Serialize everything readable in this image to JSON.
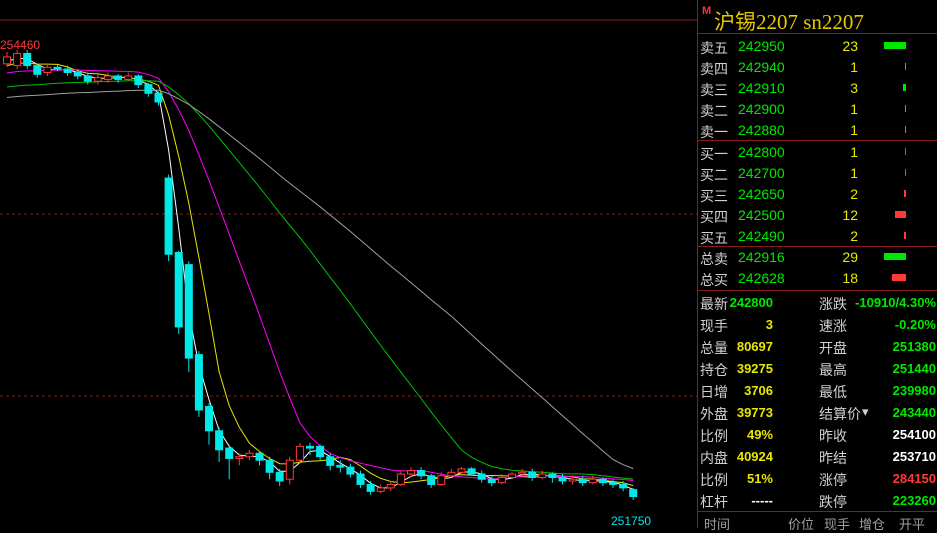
{
  "instrument": {
    "badge": "M",
    "title": "沪锡2207  sn2207"
  },
  "chart": {
    "high_label": "254460",
    "low_label": "251750"
  },
  "asks": [
    {
      "label": "卖五",
      "price": "242950",
      "vol": "23",
      "bar_len": 22
    },
    {
      "label": "卖四",
      "price": "242940",
      "vol": "1",
      "bar_len": 1
    },
    {
      "label": "卖三",
      "price": "242910",
      "vol": "3",
      "bar_len": 3
    },
    {
      "label": "卖二",
      "price": "242900",
      "vol": "1",
      "bar_len": 1
    },
    {
      "label": "卖一",
      "price": "242880",
      "vol": "1",
      "bar_len": 1
    }
  ],
  "bids": [
    {
      "label": "买一",
      "price": "242800",
      "vol": "1",
      "bar_len": 1
    },
    {
      "label": "买二",
      "price": "242700",
      "vol": "1",
      "bar_len": 1
    },
    {
      "label": "买三",
      "price": "242650",
      "vol": "2",
      "bar_len": 2
    },
    {
      "label": "买四",
      "price": "242500",
      "vol": "12",
      "bar_len": 11
    },
    {
      "label": "买五",
      "price": "242490",
      "vol": "2",
      "bar_len": 2
    }
  ],
  "totals": [
    {
      "label": "总卖",
      "price": "242916",
      "vol": "29",
      "bar_len": 22,
      "color": "#00e800"
    },
    {
      "label": "总买",
      "price": "242628",
      "vol": "18",
      "bar_len": 14,
      "color": "#ff3838"
    }
  ],
  "info_left": [
    {
      "label": "最新",
      "value": "242800",
      "cls": "grn"
    },
    {
      "label": "现手",
      "value": "3",
      "cls": "yel"
    },
    {
      "label": "总量",
      "value": "80697",
      "cls": "yel"
    },
    {
      "label": "持仓",
      "value": "39275",
      "cls": "yel"
    },
    {
      "label": "日增",
      "value": "3706",
      "cls": "yel"
    },
    {
      "label": "外盘",
      "value": "39773",
      "cls": "yel"
    },
    {
      "label": "比例",
      "value": "49%",
      "cls": "yel"
    },
    {
      "label": "内盘",
      "value": "40924",
      "cls": "yel"
    },
    {
      "label": "比例",
      "value": "51%",
      "cls": "yel"
    },
    {
      "label": "杠杆",
      "value": "-----",
      "cls": "wht"
    }
  ],
  "info_right": [
    {
      "label": "涨跌",
      "value": "-10910/4.30%",
      "cls": "grn"
    },
    {
      "label": "速涨",
      "value": "-0.20%",
      "cls": "grn"
    },
    {
      "label": "开盘",
      "value": "251380",
      "cls": "grn"
    },
    {
      "label": "最高",
      "value": "251440",
      "cls": "grn"
    },
    {
      "label": "最低",
      "value": "239980",
      "cls": "grn"
    },
    {
      "label": "结算价",
      "value": "243440",
      "cls": "grn"
    },
    {
      "label": "昨收",
      "value": "254100",
      "cls": "wht"
    },
    {
      "label": "昨结",
      "value": "253710",
      "cls": "wht"
    },
    {
      "label": "涨停",
      "value": "284150",
      "cls": "red"
    },
    {
      "label": "跌停",
      "value": "223260",
      "cls": "grn"
    }
  ],
  "tick_header": [
    "时间",
    "价位",
    "现手",
    "增仓",
    "开平"
  ],
  "colors": {
    "up": "#ff3838",
    "down": "#00e8e8",
    "ma5": "#ffffff",
    "ma10": "#e8e800",
    "ma20": "#ff00ff",
    "ma40": "#00c000",
    "ma60": "#a0a0a0"
  },
  "chart_data": {
    "type": "candlestick",
    "price_labels": [
      "254460",
      "251750"
    ],
    "candles": [
      {
        "o": 254300,
        "c": 254500,
        "h": 254650,
        "l": 254200
      },
      {
        "o": 254250,
        "c": 254600,
        "h": 254700,
        "l": 254150
      },
      {
        "o": 254600,
        "c": 254250,
        "h": 254700,
        "l": 254150
      },
      {
        "o": 254250,
        "c": 254000,
        "h": 254300,
        "l": 253900
      },
      {
        "o": 254050,
        "c": 254200,
        "h": 254300,
        "l": 253950
      },
      {
        "o": 254200,
        "c": 254150,
        "h": 254300,
        "l": 254100
      },
      {
        "o": 254150,
        "c": 254050,
        "h": 254250,
        "l": 253950
      },
      {
        "o": 254050,
        "c": 253950,
        "h": 254150,
        "l": 253850
      },
      {
        "o": 253950,
        "c": 253800,
        "h": 254050,
        "l": 253700
      },
      {
        "o": 253800,
        "c": 253900,
        "h": 254000,
        "l": 253700
      },
      {
        "o": 253850,
        "c": 253950,
        "h": 254050,
        "l": 253750
      },
      {
        "o": 253950,
        "c": 253850,
        "h": 254000,
        "l": 253750
      },
      {
        "o": 253850,
        "c": 253950,
        "h": 254050,
        "l": 253800
      },
      {
        "o": 253950,
        "c": 253700,
        "h": 254000,
        "l": 253600
      },
      {
        "o": 253700,
        "c": 253450,
        "h": 253750,
        "l": 253350
      },
      {
        "o": 253450,
        "c": 253200,
        "h": 253500,
        "l": 253100
      },
      {
        "o": 251000,
        "c": 248800,
        "h": 251100,
        "l": 248600
      },
      {
        "o": 248850,
        "c": 246700,
        "h": 248900,
        "l": 246500
      },
      {
        "o": 248500,
        "c": 245800,
        "h": 248600,
        "l": 245400
      },
      {
        "o": 245900,
        "c": 244300,
        "h": 246000,
        "l": 244100
      },
      {
        "o": 244400,
        "c": 243700,
        "h": 244500,
        "l": 243300
      },
      {
        "o": 243700,
        "c": 243150,
        "h": 243800,
        "l": 242800
      },
      {
        "o": 243200,
        "c": 242900,
        "h": 243300,
        "l": 242300
      },
      {
        "o": 242900,
        "c": 242950,
        "h": 243050,
        "l": 242700
      },
      {
        "o": 242950,
        "c": 243050,
        "h": 243150,
        "l": 242850
      },
      {
        "o": 243050,
        "c": 242850,
        "h": 243100,
        "l": 242700
      },
      {
        "o": 242850,
        "c": 242500,
        "h": 242950,
        "l": 242300
      },
      {
        "o": 242500,
        "c": 242250,
        "h": 242600,
        "l": 242100
      },
      {
        "o": 242300,
        "c": 242850,
        "h": 242950,
        "l": 242150
      },
      {
        "o": 242850,
        "c": 243250,
        "h": 243350,
        "l": 242750
      },
      {
        "o": 243250,
        "c": 243200,
        "h": 243350,
        "l": 243000
      },
      {
        "o": 243250,
        "c": 242950,
        "h": 243300,
        "l": 242850
      },
      {
        "o": 242950,
        "c": 242700,
        "h": 243050,
        "l": 242550
      },
      {
        "o": 242700,
        "c": 242650,
        "h": 242850,
        "l": 242500
      },
      {
        "o": 242650,
        "c": 242450,
        "h": 242750,
        "l": 242350
      },
      {
        "o": 242450,
        "c": 242150,
        "h": 242550,
        "l": 242050
      },
      {
        "o": 242150,
        "c": 241950,
        "h": 242250,
        "l": 241850
      },
      {
        "o": 241950,
        "c": 242050,
        "h": 242150,
        "l": 241900
      },
      {
        "o": 242050,
        "c": 242150,
        "h": 242250,
        "l": 241950
      },
      {
        "o": 242150,
        "c": 242450,
        "h": 242550,
        "l": 242100
      },
      {
        "o": 242450,
        "c": 242550,
        "h": 242650,
        "l": 242350
      },
      {
        "o": 242550,
        "c": 242400,
        "h": 242650,
        "l": 242300
      },
      {
        "o": 242400,
        "c": 242150,
        "h": 242450,
        "l": 242050
      },
      {
        "o": 242150,
        "c": 242400,
        "h": 242500,
        "l": 242100
      },
      {
        "o": 242400,
        "c": 242500,
        "h": 242600,
        "l": 242350
      },
      {
        "o": 242500,
        "c": 242600,
        "h": 242650,
        "l": 242400
      },
      {
        "o": 242600,
        "c": 242450,
        "h": 242650,
        "l": 242400
      },
      {
        "o": 242450,
        "c": 242300,
        "h": 242550,
        "l": 242200
      },
      {
        "o": 242300,
        "c": 242200,
        "h": 242400,
        "l": 242100
      },
      {
        "o": 242200,
        "c": 242350,
        "h": 242450,
        "l": 242150
      },
      {
        "o": 242350,
        "c": 242450,
        "h": 242500,
        "l": 242300
      },
      {
        "o": 242450,
        "c": 242500,
        "h": 242600,
        "l": 242400
      },
      {
        "o": 242500,
        "c": 242350,
        "h": 242600,
        "l": 242250
      },
      {
        "o": 242350,
        "c": 242450,
        "h": 242550,
        "l": 242300
      },
      {
        "o": 242450,
        "c": 242350,
        "h": 242500,
        "l": 242200
      },
      {
        "o": 242350,
        "c": 242250,
        "h": 242450,
        "l": 242150
      },
      {
        "o": 242250,
        "c": 242300,
        "h": 242400,
        "l": 242150
      },
      {
        "o": 242300,
        "c": 242200,
        "h": 242400,
        "l": 242100
      },
      {
        "o": 242200,
        "c": 242300,
        "h": 242400,
        "l": 242150
      },
      {
        "o": 242300,
        "c": 242200,
        "h": 242350,
        "l": 242100
      },
      {
        "o": 242200,
        "c": 242150,
        "h": 242300,
        "l": 242050
      },
      {
        "o": 242150,
        "c": 242050,
        "h": 242250,
        "l": 241950
      },
      {
        "o": 242000,
        "c": 241800,
        "h": 242050,
        "l": 241700
      }
    ]
  }
}
